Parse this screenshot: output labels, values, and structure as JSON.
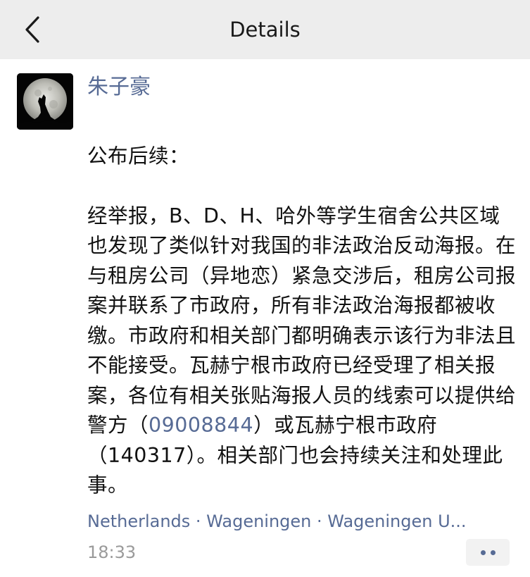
{
  "navbar": {
    "title": "Details",
    "back_icon": "chevron-left-icon"
  },
  "post": {
    "author": "朱子豪",
    "avatar_icon": "wolf-howling-at-moon-avatar",
    "heading": "公布后续：",
    "body_before_phone": "经举报，B、D、H、哈外等学生宿舍公共区域也发现了类似针对我国的非法政治反动海报。在与租房公司（异地恋）紧急交涉后，租房公司报案并联系了市政府，所有非法政治海报都被收缴。市政府和相关部门都明确表示该行为非法且不能接受。瓦赫宁根市政府已经受理了相关报案，各位有相关张贴海报人员的线索可以提供给警方（",
    "phone": "09008844",
    "body_after_phone": "）或瓦赫宁根市政府（140317）。相关部门也会持续关注和处理此事。",
    "location": "Netherlands · Wageningen · Wageningen U...",
    "time": "18:33",
    "more_icon": "more-dots-icon"
  },
  "colors": {
    "nav_bg": "#ededed",
    "link": "#576b95",
    "text": "#111111",
    "time": "#9a9a9a"
  }
}
